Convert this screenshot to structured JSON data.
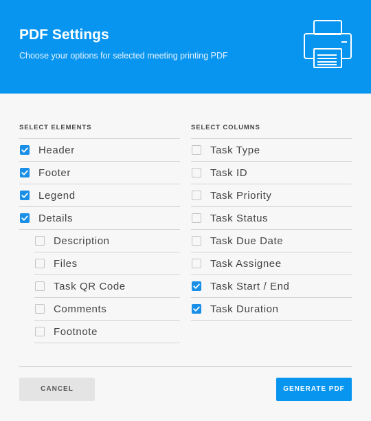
{
  "header": {
    "title": "PDF Settings",
    "subtitle": "Choose your options for selected meeting printing PDF",
    "icon": "printer-icon",
    "background": "#0895f0"
  },
  "elements": {
    "heading": "SELECT ELEMENTS",
    "items": [
      {
        "label": "Header",
        "checked": true
      },
      {
        "label": "Footer",
        "checked": true
      },
      {
        "label": "Legend",
        "checked": true
      },
      {
        "label": "Details",
        "checked": true
      }
    ],
    "details_children": [
      {
        "label": "Description",
        "checked": false
      },
      {
        "label": "Files",
        "checked": false
      },
      {
        "label": "Task QR Code",
        "checked": false
      },
      {
        "label": "Comments",
        "checked": false
      },
      {
        "label": "Footnote",
        "checked": false
      }
    ]
  },
  "columns": {
    "heading": "SELECT COLUMNS",
    "items": [
      {
        "label": "Task Type",
        "checked": false
      },
      {
        "label": "Task ID",
        "checked": false
      },
      {
        "label": "Task Priority",
        "checked": false
      },
      {
        "label": "Task Status",
        "checked": false
      },
      {
        "label": "Task Due Date",
        "checked": false
      },
      {
        "label": "Task Assignee",
        "checked": false
      },
      {
        "label": "Task Start / End",
        "checked": true
      },
      {
        "label": "Task Duration",
        "checked": true
      }
    ]
  },
  "actions": {
    "cancel_label": "CANCEL",
    "generate_label": "GENERATE PDF"
  },
  "colors": {
    "accent": "#0895f0",
    "checkbox_checked": "#1a8fe8"
  }
}
